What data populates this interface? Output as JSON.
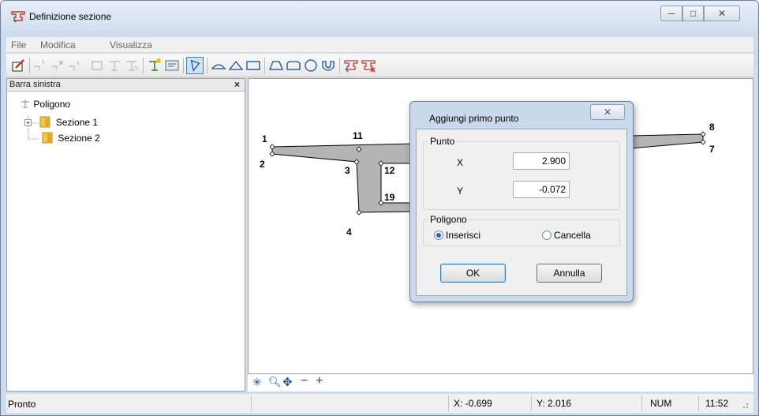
{
  "window": {
    "title": "Definizione sezione",
    "minimize": "─",
    "maximize": "□",
    "close": "✕"
  },
  "menu": [
    "File",
    "Modifica",
    "Visualizza"
  ],
  "left_pane": {
    "header": "Barra sinistra",
    "close": "×",
    "tree": {
      "root": "Poligono",
      "items": [
        "Sezione 1",
        "Sezione 2"
      ],
      "expander": "⊞"
    }
  },
  "canvas": {
    "point_labels": [
      "1",
      "2",
      "3",
      "4",
      "11",
      "12",
      "19",
      "8",
      "7"
    ],
    "zoom_tools": [
      "✳",
      "🔍︎",
      "✥",
      "−",
      "+"
    ]
  },
  "dialog": {
    "title": "Aggiungi primo punto",
    "close": "✕",
    "punto_group": "Punto",
    "x_label": "X",
    "x_value": "2.900",
    "y_label": "Y",
    "y_value": "-0.072",
    "poligono_group": "Poligono",
    "radio_insert": "Inserisci",
    "radio_delete": "Cancella",
    "selected": "Inserisci",
    "ok": "OK",
    "cancel": "Annulla"
  },
  "status": {
    "text": "Pronto",
    "x": "X: -0.699",
    "y": "Y: 2.016",
    "num": "NUM",
    "time": "11:52"
  }
}
